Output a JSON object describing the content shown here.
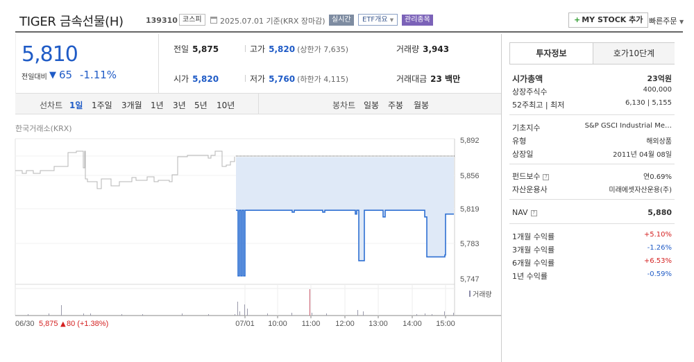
{
  "header": {
    "title": "TIGER 금속선물(H)",
    "code": "139310",
    "market": "코스피",
    "date": "2025.07.01  기준(KRX 장마감)",
    "realtime": "실시간",
    "etf_overview": "ETF개요",
    "managed": "관리종목",
    "my_stock": "MY STOCK 추가",
    "quick_order": "빠른주문"
  },
  "quote": {
    "price": "5,810",
    "prev_label": "전일대비",
    "change": "65",
    "change_pct": "-1.11%",
    "prev_close_label": "전일",
    "prev_close": "5,875",
    "high_label": "고가",
    "high": "5,820",
    "upper_limit": "(상한가 7,635)",
    "volume_label": "거래량",
    "volume": "3,943",
    "open_label": "시가",
    "open": "5,820",
    "low_label": "저가",
    "low": "5,760",
    "lower_limit": "(하한가 4,115)",
    "amount_label": "거래대금",
    "amount": "23 백만"
  },
  "tabs": {
    "line_label": "선차트",
    "periods": [
      "1일",
      "1주일",
      "3개월",
      "1년",
      "3년",
      "5년",
      "10년"
    ],
    "candle_label": "봉차트",
    "candles": [
      "일봉",
      "주봉",
      "월봉"
    ]
  },
  "chart": {
    "source": "한국거래소(KRX)",
    "y_ticks": [
      "5,892",
      "5,856",
      "5,819",
      "5,783",
      "5,747"
    ],
    "volume_label": "거래량",
    "x_labels": [
      "07/01",
      "10:00",
      "11:00",
      "12:00",
      "13:00",
      "14:00",
      "15:00"
    ],
    "prev_date": "06/30",
    "prev_close": "5,875",
    "prev_change": "80 (+1.38%)"
  },
  "chart_data": {
    "type": "line",
    "title": "",
    "ylim": [
      5747,
      5892
    ],
    "x_ticks": [
      "07/01",
      "10:00",
      "11:00",
      "12:00",
      "13:00",
      "14:00",
      "15:00"
    ],
    "y_ticks": [
      5892,
      5856,
      5819,
      5783,
      5747
    ],
    "prev_close_ref": 5875,
    "series": [
      {
        "values": [
          5819,
          5819,
          5750,
          5819,
          5750,
          5819,
          5750,
          5819,
          5819,
          5817,
          5819,
          5819,
          5817,
          5819,
          5819,
          5819,
          5815,
          5819,
          5819,
          5819,
          5766,
          5766,
          5819,
          5819,
          5819,
          5812,
          5819,
          5819,
          5819,
          5812,
          5812,
          5770,
          5770,
          5772,
          5815,
          5815
        ]
      }
    ]
  },
  "panel": {
    "tab_info": "투자정보",
    "tab_orderbook": "호가10단계",
    "rows1": [
      {
        "k": "시가총액",
        "v": "23억원"
      },
      {
        "k": "상장주식수",
        "v": "400,000"
      },
      {
        "k": "52주최고 | 최저",
        "v": "6,130 | 5,155"
      }
    ],
    "rows2": [
      {
        "k": "기초지수",
        "v": "S&P GSCI Industrial Me…"
      },
      {
        "k": "유형",
        "v": "해외상품"
      },
      {
        "k": "상장일",
        "v": "2011년 04월 08일"
      }
    ],
    "rows3": [
      {
        "k": "펀드보수",
        "v": "연0.69%"
      },
      {
        "k": "자산운용사",
        "v": "미래에셋자산운용(주)"
      }
    ],
    "nav": {
      "k": "NAV",
      "v": "5,880"
    },
    "returns": [
      {
        "k": "1개월 수익률",
        "v": "+5.10%",
        "c": "red"
      },
      {
        "k": "3개월 수익률",
        "v": "-1.26%",
        "c": "blue"
      },
      {
        "k": "6개월 수익률",
        "v": "+6.53%",
        "c": "red"
      },
      {
        "k": "1년 수익률",
        "v": "-0.59%",
        "c": "blue"
      }
    ],
    "colors": {
      "up": "#d42020",
      "down": "#1f5bc6"
    }
  }
}
